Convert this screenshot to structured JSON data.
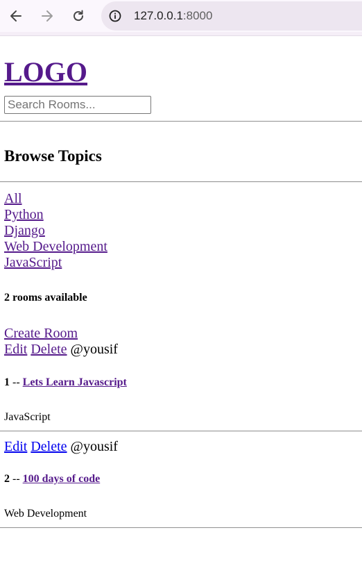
{
  "browser": {
    "url_host": "127.0.0.1",
    "url_port": ":8000"
  },
  "header": {
    "logo": "LOGO"
  },
  "search": {
    "placeholder": "Search Rooms..."
  },
  "topics": {
    "title": "Browse Topics",
    "items": [
      "All",
      "Python",
      "Django",
      "Web Development",
      "JavaScript"
    ]
  },
  "rooms": {
    "count_text": "2 rooms available",
    "create_label": "Create Room",
    "list": [
      {
        "edit_label": "Edit",
        "delete_label": "Delete",
        "host": "@yousif",
        "number": "1",
        "separator": " -- ",
        "name": "Lets Learn Javascript",
        "topic": "JavaScript"
      },
      {
        "edit_label": "Edit",
        "delete_label": "Delete",
        "host": "@yousif",
        "number": "2",
        "separator": " -- ",
        "name": "100 days of code",
        "topic": "Web Development"
      }
    ]
  },
  "colors": {
    "visited_link": "#551a8b",
    "unvisited_link": "#0000ee"
  },
  "icons": {
    "back": "arrow-left-icon",
    "forward": "arrow-right-icon",
    "reload": "reload-icon",
    "site_info": "info-icon"
  }
}
